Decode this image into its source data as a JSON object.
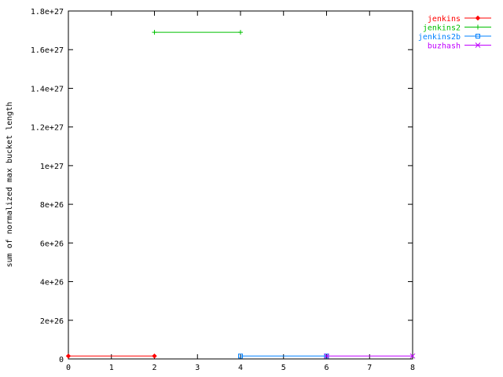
{
  "chart_data": {
    "type": "line",
    "title": "",
    "xlabel": "",
    "ylabel": "sum of normalized max bucket length",
    "xlim": [
      0,
      8
    ],
    "ylim": [
      0,
      1.8e+27
    ],
    "x_ticks": [
      0,
      1,
      2,
      3,
      4,
      5,
      6,
      7,
      8
    ],
    "x_tick_labels": [
      "0",
      "1",
      "2",
      "3",
      "4",
      "5",
      "6",
      "7",
      "8"
    ],
    "y_ticks": [
      0,
      2e+26,
      4e+26,
      6e+26,
      8e+26,
      1e+27,
      1.2e+27,
      1.4e+27,
      1.6e+27,
      1.8e+27
    ],
    "y_tick_labels": [
      "0",
      "2e+26",
      "4e+26",
      "6e+26",
      "8e+26",
      "1e+27",
      "1.2e+27",
      "1.4e+27",
      "1.6e+27",
      "1.8e+27"
    ],
    "grid": false,
    "legend_position": "top-right outside",
    "series": [
      {
        "name": "jenkins",
        "color": "#ff0000",
        "marker": "diamond",
        "x": [
          0,
          2
        ],
        "y": [
          1.5e+25,
          1.5e+25
        ]
      },
      {
        "name": "jenkins2",
        "color": "#00c000",
        "marker": "plus",
        "x": [
          2,
          4
        ],
        "y": [
          1.69e+27,
          1.69e+27
        ]
      },
      {
        "name": "jenkins2b",
        "color": "#0080ff",
        "marker": "square",
        "x": [
          4,
          6
        ],
        "y": [
          1.5e+25,
          1.5e+25
        ]
      },
      {
        "name": "buzhash",
        "color": "#c000ff",
        "marker": "cross",
        "x": [
          6,
          8
        ],
        "y": [
          1.5e+25,
          1.5e+25
        ]
      }
    ]
  }
}
